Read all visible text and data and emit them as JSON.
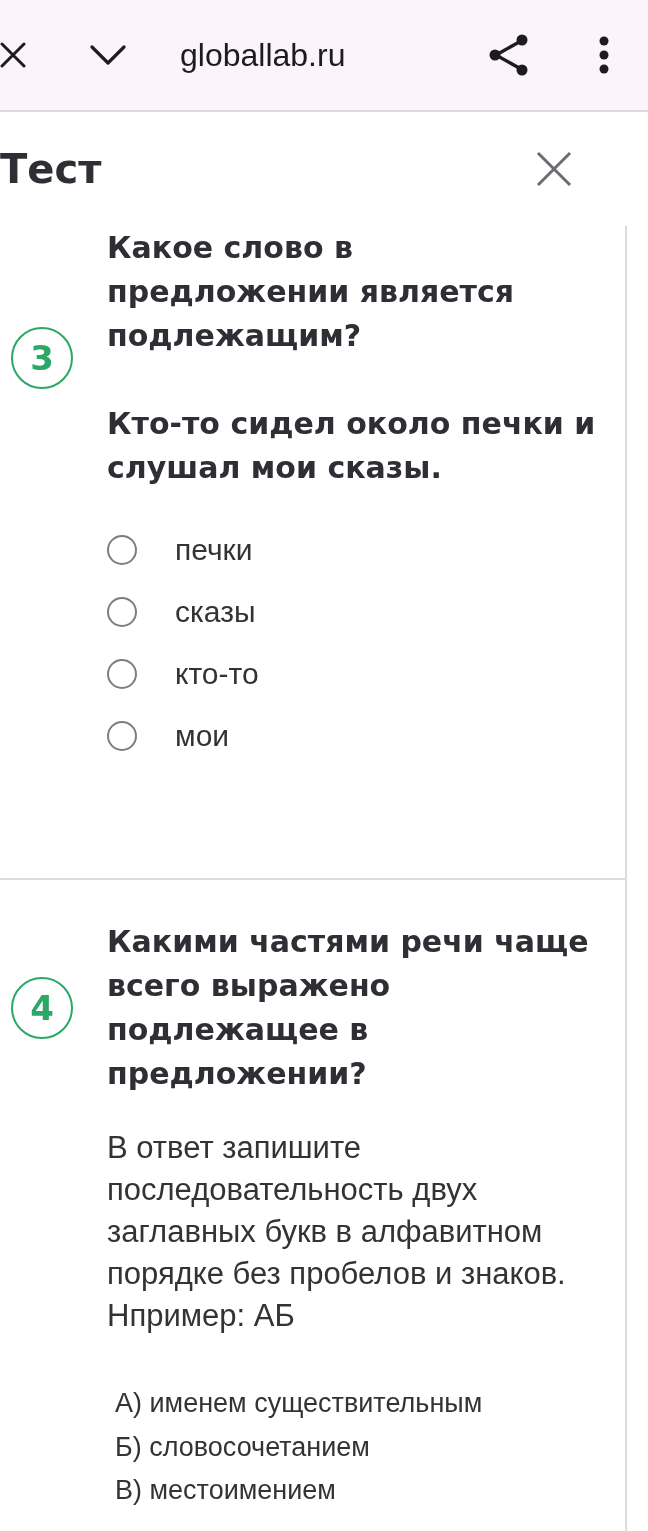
{
  "browser_bar": {
    "url": "globallab.ru"
  },
  "header": {
    "title": "Тест"
  },
  "questions": [
    {
      "number": "3",
      "title": "Какое слово в предложении является подлежащим?",
      "sentence": "Кто-то сидел около печки и слушал мои сказы.",
      "options": [
        {
          "label": "печки",
          "selected": false
        },
        {
          "label": "сказы",
          "selected": false
        },
        {
          "label": "кто-то",
          "selected": false
        },
        {
          "label": "мои",
          "selected": false
        }
      ]
    },
    {
      "number": "4",
      "title": "Какими частями речи чаще всего выражено подлежащее в предложении?",
      "instruction": "В ответ запишите последовательность двух заглавных букв в алфавитном порядке без пробелов и знаков. Нпример: АБ",
      "choices": [
        "А) именем существительным",
        "Б) словосочетанием",
        "В) местоимением"
      ]
    }
  ]
}
